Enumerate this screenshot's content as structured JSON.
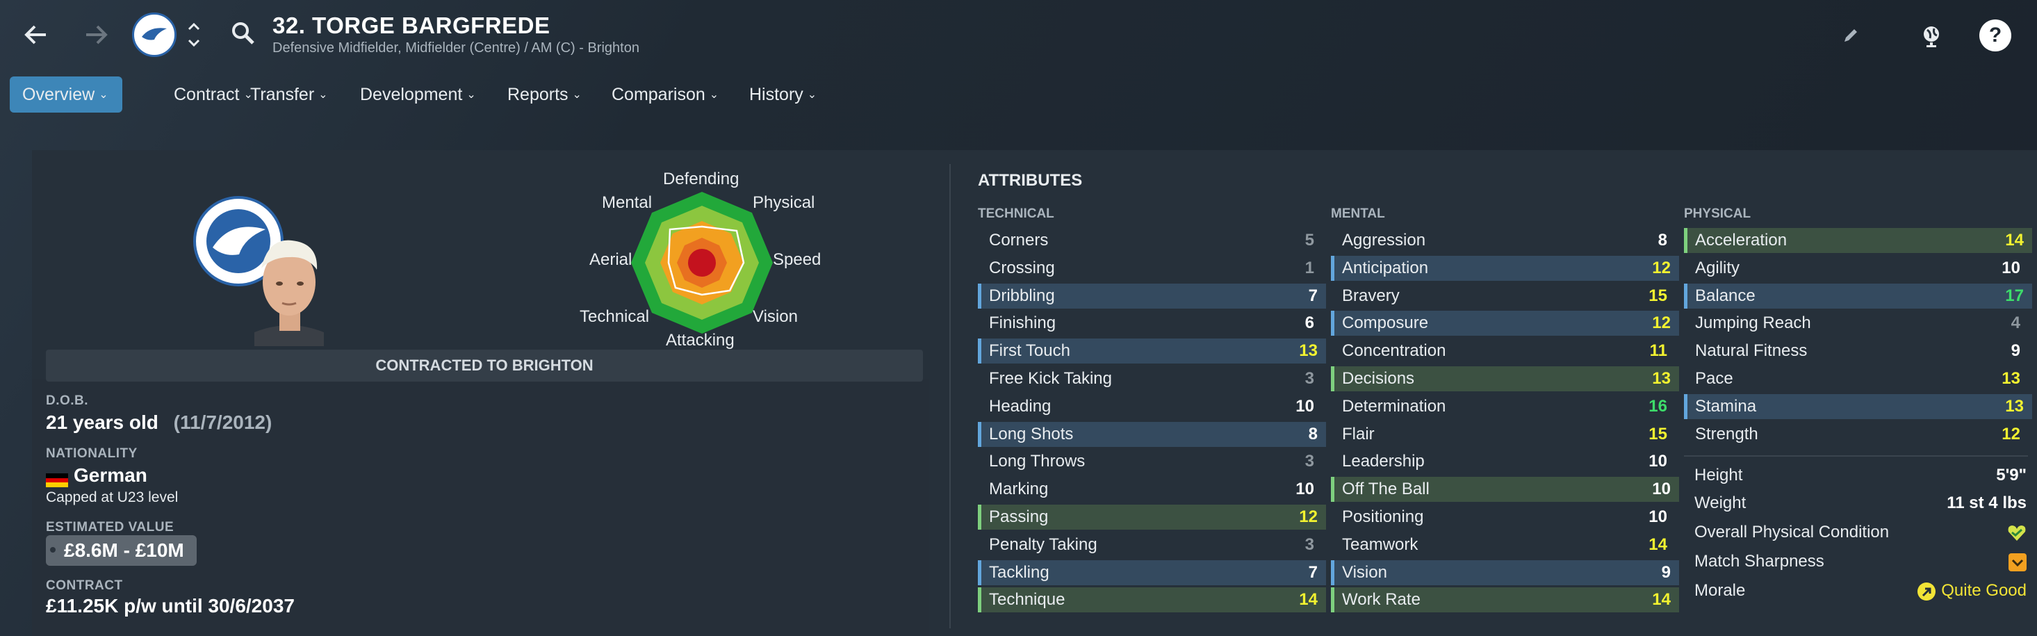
{
  "header": {
    "title": "32. TORGE BARGFREDE",
    "subtitle": "Defensive Midfielder, Midfielder (Centre) / AM (C) - Brighton"
  },
  "tabs": [
    {
      "label": "Overview"
    },
    {
      "label": "Contract"
    },
    {
      "label": "Transfer"
    },
    {
      "label": "Development"
    },
    {
      "label": "Reports"
    },
    {
      "label": "Comparison"
    },
    {
      "label": "History"
    }
  ],
  "radar": {
    "labels": [
      "Defending",
      "Physical",
      "Speed",
      "Vision",
      "Attacking",
      "Technical",
      "Aerial",
      "Mental"
    ]
  },
  "profile": {
    "contract_banner": "CONTRACTED TO BRIGHTON",
    "dob_label": "D.O.B.",
    "dob_age": "21 years old",
    "dob_date": "(11/7/2012)",
    "nationality_label": "NATIONALITY",
    "nationality": "German",
    "caps": "Capped at U23 level",
    "value_label": "ESTIMATED VALUE",
    "value": "£8.6M - £10M",
    "contract_label": "CONTRACT",
    "contract": "£11.25K p/w until 30/6/2037"
  },
  "attributes": {
    "title": "ATTRIBUTES",
    "technical_label": "TECHNICAL",
    "mental_label": "MENTAL",
    "physical_label": "PHYSICAL",
    "technical": [
      {
        "name": "Corners",
        "value": "5",
        "hl": ""
      },
      {
        "name": "Crossing",
        "value": "1",
        "hl": ""
      },
      {
        "name": "Dribbling",
        "value": "7",
        "hl": "blue"
      },
      {
        "name": "Finishing",
        "value": "6",
        "hl": ""
      },
      {
        "name": "First Touch",
        "value": "13",
        "hl": "blue"
      },
      {
        "name": "Free Kick Taking",
        "value": "3",
        "hl": ""
      },
      {
        "name": "Heading",
        "value": "10",
        "hl": ""
      },
      {
        "name": "Long Shots",
        "value": "8",
        "hl": "blue"
      },
      {
        "name": "Long Throws",
        "value": "3",
        "hl": ""
      },
      {
        "name": "Marking",
        "value": "10",
        "hl": ""
      },
      {
        "name": "Passing",
        "value": "12",
        "hl": "green"
      },
      {
        "name": "Penalty Taking",
        "value": "3",
        "hl": ""
      },
      {
        "name": "Tackling",
        "value": "7",
        "hl": "blue"
      },
      {
        "name": "Technique",
        "value": "14",
        "hl": "green"
      }
    ],
    "mental": [
      {
        "name": "Aggression",
        "value": "8",
        "hl": ""
      },
      {
        "name": "Anticipation",
        "value": "12",
        "hl": "blue"
      },
      {
        "name": "Bravery",
        "value": "15",
        "hl": ""
      },
      {
        "name": "Composure",
        "value": "12",
        "hl": "blue"
      },
      {
        "name": "Concentration",
        "value": "11",
        "hl": ""
      },
      {
        "name": "Decisions",
        "value": "13",
        "hl": "green"
      },
      {
        "name": "Determination",
        "value": "16",
        "hl": ""
      },
      {
        "name": "Flair",
        "value": "15",
        "hl": ""
      },
      {
        "name": "Leadership",
        "value": "10",
        "hl": ""
      },
      {
        "name": "Off The Ball",
        "value": "10",
        "hl": "green"
      },
      {
        "name": "Positioning",
        "value": "10",
        "hl": ""
      },
      {
        "name": "Teamwork",
        "value": "14",
        "hl": ""
      },
      {
        "name": "Vision",
        "value": "9",
        "hl": "blue"
      },
      {
        "name": "Work Rate",
        "value": "14",
        "hl": "green"
      }
    ],
    "physical": [
      {
        "name": "Acceleration",
        "value": "14",
        "hl": "green"
      },
      {
        "name": "Agility",
        "value": "10",
        "hl": ""
      },
      {
        "name": "Balance",
        "value": "17",
        "hl": "blue"
      },
      {
        "name": "Jumping Reach",
        "value": "4",
        "hl": ""
      },
      {
        "name": "Natural Fitness",
        "value": "9",
        "hl": ""
      },
      {
        "name": "Pace",
        "value": "13",
        "hl": ""
      },
      {
        "name": "Stamina",
        "value": "13",
        "hl": "blue"
      },
      {
        "name": "Strength",
        "value": "12",
        "hl": ""
      }
    ],
    "physical_info": {
      "height_label": "Height",
      "height": "5'9\"",
      "weight_label": "Weight",
      "weight": "11 st 4 lbs",
      "condition_label": "Overall Physical Condition",
      "sharpness_label": "Match Sharpness",
      "morale_label": "Morale",
      "morale": "Quite Good"
    }
  },
  "colors": {
    "accent": "#3d86b8",
    "value_good": "#f2f230",
    "value_great": "#3ddc6a",
    "highlight_blue": "#62a6dd",
    "highlight_green": "#7ed07e"
  }
}
